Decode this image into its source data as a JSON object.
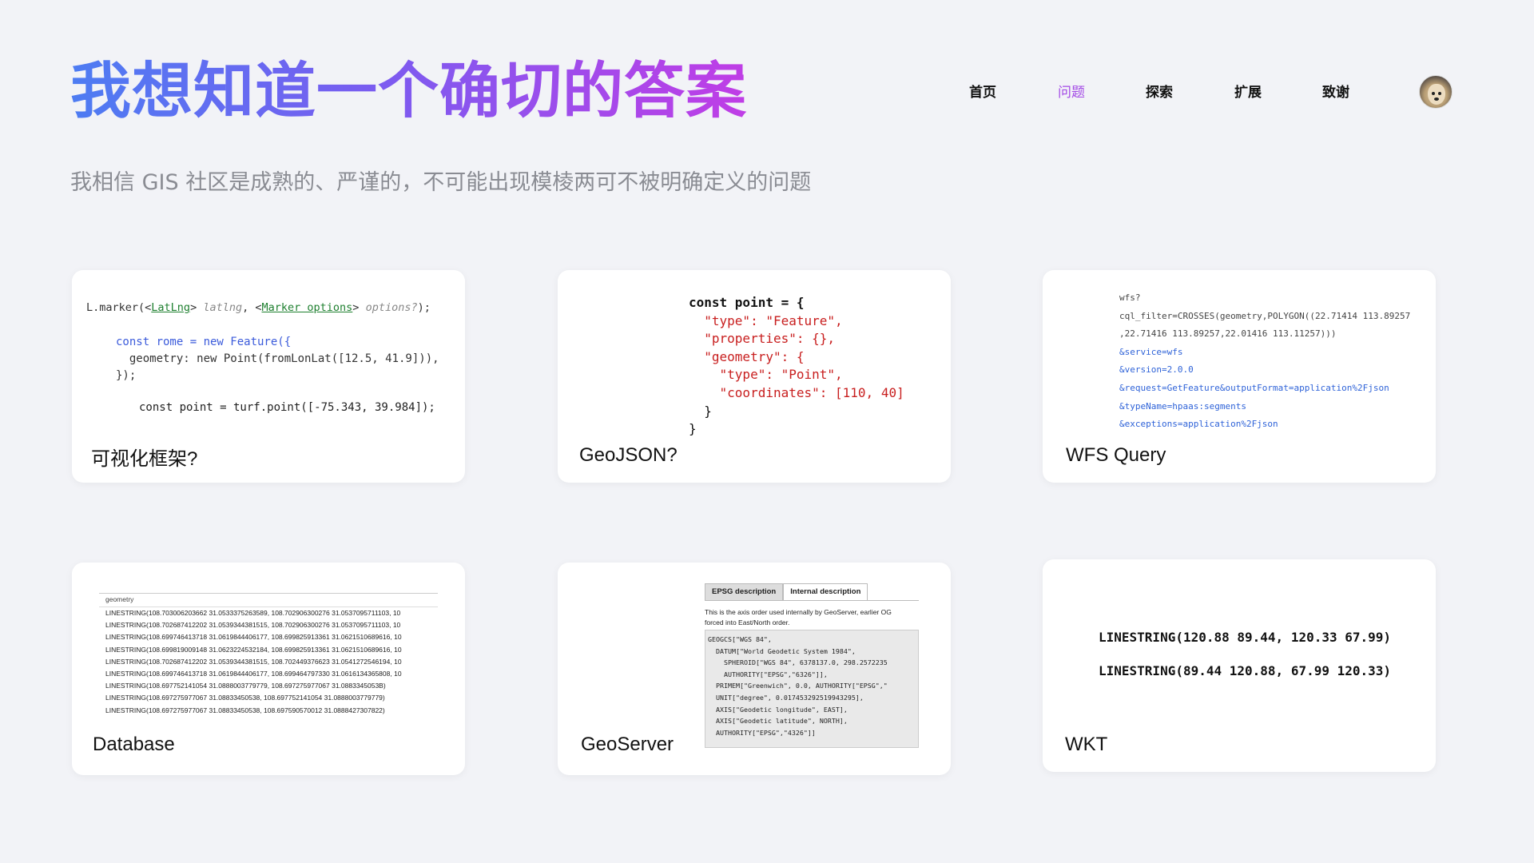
{
  "title": "我想知道一个确切的答案",
  "subtitle": "我相信 GIS 社区是成熟的、严谨的，不可能出现模棱两可不被明确定义的问题",
  "nav": {
    "items": [
      {
        "label": "首页"
      },
      {
        "label": "问题"
      },
      {
        "label": "探索"
      },
      {
        "label": "扩展"
      },
      {
        "label": "致谢"
      }
    ],
    "active": "问题"
  },
  "cards": {
    "viz": {
      "label": "可视化框架?",
      "line1_fn": "L.marker(<",
      "line1_a": "LatLng",
      "line1_b": "> ",
      "line1_c": "latlng",
      "line1_d": ", <",
      "line1_e": "Marker options",
      "line1_f": "> ",
      "line1_g": "options?",
      "line1_h": ");",
      "line2": "const rome = new Feature({",
      "line3": "  geometry: new Point(fromLonLat([12.5, 41.9])),",
      "line4": "});",
      "line5": "const point = turf.point([-75.343, 39.984]);"
    },
    "geojson": {
      "label": "GeoJSON?",
      "lines": [
        "const point = {",
        "  \"type\": \"Feature\",",
        "  \"properties\": {},",
        "  \"geometry\": {",
        "    \"type\": \"Point\",",
        "    \"coordinates\": [110, 40]",
        "  }",
        "}"
      ]
    },
    "wfs": {
      "label": "WFS Query",
      "lines": [
        "wfs?",
        "cql_filter=CROSSES(geometry,POLYGON((22.71414 113.89257",
        ",22.71416 113.89257,22.01416 113.11257)))",
        "&service=wfs",
        "&version=2.0.0",
        "&request=GetFeature&outputFormat=application%2Fjson",
        "&typeName=hpaas:segments",
        "&exceptions=application%2Fjson"
      ]
    },
    "database": {
      "label": "Database",
      "header": "geometry",
      "rows": [
        "LINESTRING(108.703006203662 31.0533375263589, 108.702906300276 31.0537095711103, 10",
        "LINESTRING(108.702687412202 31.0539344381515, 108.702906300276 31.0537095711103, 10",
        "LINESTRING(108.699746413718 31.0619844406177, 108.699825913361 31.0621510689616, 10",
        "LINESTRING(108.699819009148 31.0623224532184, 108.699825913361 31.0621510689616, 10",
        "LINESTRING(108.702687412202 31.0539344381515, 108.702449376623 31.0541272546194, 10",
        "LINESTRING(108.699746413718 31.0619844406177, 108.699464797330 31.0616134365808, 10",
        "LINESTRING(108.697752141054 31.0888003779779, 108.697275977067 31.0883345053B)",
        "LINESTRING(108.697275977067 31.08833450538, 108.697752141054 31.0888003779779)",
        "LINESTRING(108.697275977067 31.08833450538, 108.697590570012 31.0888427307822)"
      ]
    },
    "geoserver": {
      "label": "GeoServer",
      "tab1": "EPSG description",
      "tab2": "Internal description",
      "desc1": "This is the axis order used internally by GeoServer, earlier OG",
      "desc2": "forced into East/North order.",
      "wkt": "GEOGCS[\"WGS 84\",\n  DATUM[\"World Geodetic System 1984\",\n    SPHEROID[\"WGS 84\", 6378137.0, 298.2572235\n    AUTHORITY[\"EPSG\",\"6326\"]],\n  PRIMEM[\"Greenwich\", 0.0, AUTHORITY[\"EPSG\",\"\n  UNIT[\"degree\", 0.017453292519943295],\n  AXIS[\"Geodetic longitude\", EAST],\n  AXIS[\"Geodetic latitude\", NORTH],\n  AUTHORITY[\"EPSG\",\"4326\"]]"
    },
    "wkt": {
      "label": "WKT",
      "line1": "LINESTRING(120.88 89.44, 120.33 67.99)",
      "line2": "LINESTRING(89.44 120.88, 67.99 120.33)"
    }
  }
}
